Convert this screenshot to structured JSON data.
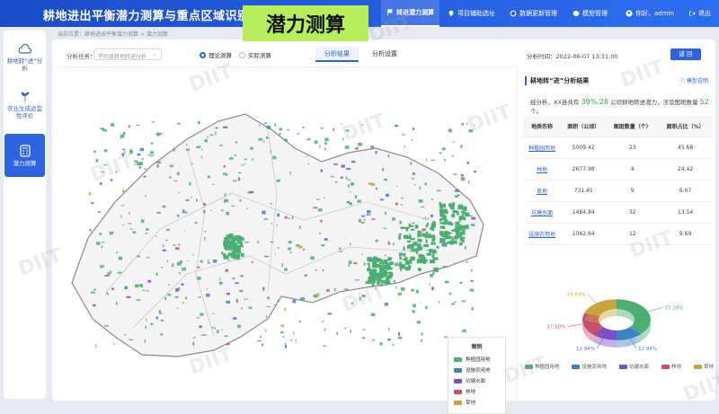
{
  "header": {
    "title": "耕地进出平衡潜力测算与重点区域识别",
    "badge": "潜力测算",
    "nav": [
      {
        "label": "转进潜力测算",
        "icon": "flag-icon",
        "active": true
      },
      {
        "label": "项目辅助选址",
        "icon": "location-pin-icon",
        "active": false
      },
      {
        "label": "数据更新管理",
        "icon": "refresh-icon",
        "active": false
      },
      {
        "label": "模型管理",
        "icon": "model-icon",
        "active": false
      }
    ],
    "user": "你好，admin",
    "logout": "退出"
  },
  "sidebar": {
    "items": [
      {
        "label": "耕地转“进”分析",
        "icon": "cloud-analysis-icon",
        "active": false
      },
      {
        "label": "农业生成适宜性评价",
        "icon": "sprout-icon",
        "active": false
      },
      {
        "label": "潜力测算",
        "icon": "calculator-icon",
        "active": true
      }
    ]
  },
  "breadcrumb": "当前位置：耕地进出平衡潜力测算 > 潜力测算",
  "toolbar": {
    "task_label": "分析任务：",
    "task_placeholder": "平阴县耕地转进分析",
    "radio_theory": "理论测算",
    "radio_actual": "实际测算",
    "tab_result": "分析结果",
    "tab_settings": "分析设置",
    "time": "分析时间：2022-06-07 13:31:00",
    "back": "返 回"
  },
  "legend": {
    "title": "图例",
    "items": [
      {
        "label": "种植园用地",
        "color": "#4caf72"
      },
      {
        "label": "设施农用地",
        "color": "#3b83c4"
      },
      {
        "label": "坑塘水面",
        "color": "#7b4fc9"
      },
      {
        "label": "林地",
        "color": "#c94f6e"
      },
      {
        "label": "草地",
        "color": "#c9a43b"
      }
    ]
  },
  "right": {
    "title": "耕地转“进”分析结果",
    "help": "模型说明",
    "summary_pre": "经分析，XX县共有",
    "summary_area": "39%.28",
    "summary_mid": "公顷耕地转进潜力，涉及图斑数量",
    "summary_count": "52",
    "summary_post": "个。",
    "columns": [
      "地类名称",
      "面积（公顷）",
      "图斑数量（个）",
      "面积占比（%）"
    ],
    "rows": [
      [
        "种植园用地",
        "5009.42",
        "23",
        "45.68"
      ],
      [
        "林地",
        "2677.98",
        "4",
        "24.42"
      ],
      [
        "草地",
        "731.45",
        "9",
        "6.67"
      ],
      [
        "坑塘水面",
        "1484.84",
        "32",
        "13.54"
      ],
      [
        "设施农用地",
        "1062.64",
        "12",
        "9.69"
      ]
    ]
  },
  "chart_data": {
    "type": "pie",
    "labels": [
      "种植园用地",
      "设施农用地",
      "坑塘水面",
      "林地",
      "草地"
    ],
    "values": [
      37.28,
      12.94,
      12.94,
      17.5,
      19.83
    ],
    "slice_labels": [
      "37.28%",
      "12.94%",
      "12.94%",
      "17.50%",
      "19.83%"
    ],
    "colors": [
      "#4caf72",
      "#3b83c4",
      "#7b4fc9",
      "#c94f6e",
      "#c9a43b"
    ],
    "legend_position": "bottom"
  },
  "watermark": "DIIT"
}
